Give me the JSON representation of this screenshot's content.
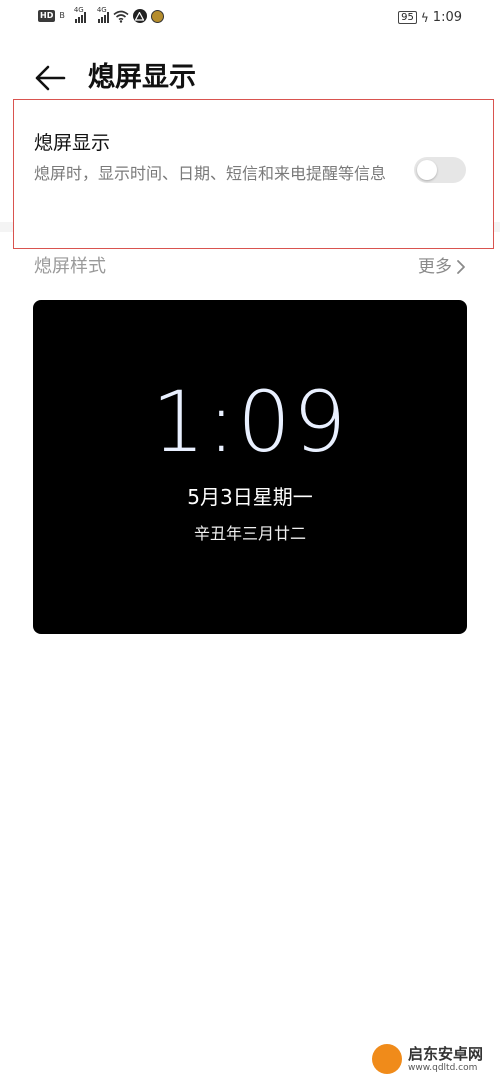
{
  "status_bar": {
    "hd": "HD",
    "sim": "B",
    "net1": "4G",
    "net2": "4G",
    "battery": "95",
    "time": "1:09"
  },
  "header": {
    "title": "熄屏显示"
  },
  "setting": {
    "title": "熄屏显示",
    "description": "熄屏时，显示时间、日期、短信和来电提醒等信息",
    "enabled": false
  },
  "style_section": {
    "label": "熄屏样式",
    "more": "更多"
  },
  "preview": {
    "time": "1:09",
    "date": "5月3日星期一",
    "lunar": "辛丑年三月廿二"
  },
  "watermark": {
    "name": "启东安卓网",
    "url": "www.qdltd.com"
  },
  "colors": {
    "highlight_border": "#d9534f",
    "preview_bg": "#000000",
    "toggle_off": "#e6e6e6",
    "watermark_orange": "#f08b1a"
  },
  "icons": {
    "back": "arrow-left-icon",
    "more": "chevron-right-icon",
    "wifi": "wifi-icon",
    "battery": "battery-icon",
    "charging": "lightning-bolt-icon"
  }
}
